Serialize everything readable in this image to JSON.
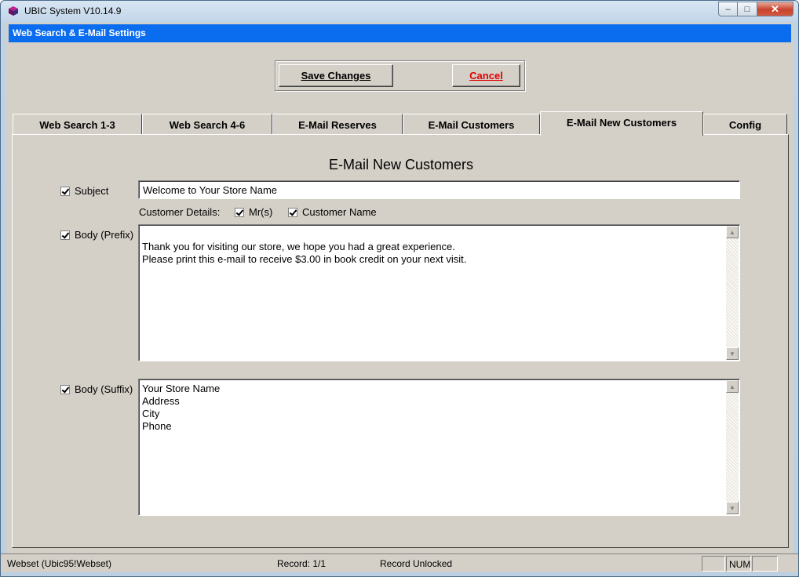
{
  "window": {
    "title": "UBIC System V10.14.9",
    "min_symbol": "–",
    "max_symbol": "□",
    "close_symbol": "✕"
  },
  "form": {
    "title": "Web Search & E-Mail Settings"
  },
  "buttons": {
    "save_label": "Save Changes",
    "cancel_label": "Cancel"
  },
  "tabs": [
    {
      "label": "Web Search 1-3",
      "active": false
    },
    {
      "label": "Web Search 4-6",
      "active": false
    },
    {
      "label": "E-Mail Reserves",
      "active": false
    },
    {
      "label": "E-Mail Customers",
      "active": false
    },
    {
      "label": "E-Mail New Customers",
      "active": true
    },
    {
      "label": "Config",
      "active": false
    }
  ],
  "panel": {
    "heading": "E-Mail New Customers",
    "subject_label": "Subject",
    "subject_checked": true,
    "subject_value": "Welcome to Your Store Name",
    "customer_details_label": "Customer Details:",
    "mrs_label": "Mr(s)",
    "mrs_checked": true,
    "customer_name_label": "Customer Name",
    "customer_name_checked": true,
    "body_prefix_label": "Body (Prefix)",
    "body_prefix_checked": true,
    "body_prefix_text": "\nThank you for visiting our store, we hope you had a great experience.\nPlease print this e-mail to receive $3.00 in book credit on your next visit.",
    "body_suffix_label": "Body (Suffix)",
    "body_suffix_checked": true,
    "body_suffix_text": "Your Store Name\nAddress\nCity\nPhone"
  },
  "statusbar": {
    "webset": "Webset (Ubic95!Webset)",
    "record": "Record: 1/1",
    "lock": "Record Unlocked",
    "num": "NUM"
  }
}
